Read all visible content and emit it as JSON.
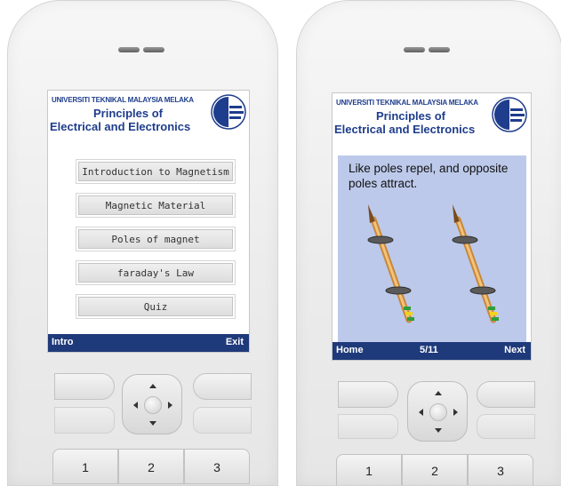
{
  "header": {
    "university": "UNIVERSITI TEKNIKAL MALAYSIA MELAKA",
    "title_line1": "Principles of",
    "title_line2": "Electrical and Electronics"
  },
  "menu_screen": {
    "buttons": [
      "Introduction to Magnetism",
      "Magnetic Material",
      "Poles of magnet",
      "faraday's Law",
      "Quiz"
    ],
    "softkey_left": "Intro",
    "softkey_right": "Exit"
  },
  "slide_screen": {
    "text": "Like poles repel, and opposite poles attract.",
    "softkey_left": "Home",
    "page_indicator": "5/11",
    "softkey_right": "Next"
  },
  "keypad": {
    "numbers": [
      "1",
      "2",
      "3"
    ]
  },
  "colors": {
    "brand_blue": "#1e3d8c",
    "softbar": "#1f3a7a",
    "slide_bg": "#bcc9ea"
  },
  "icons": [
    "university-logo",
    "dpad-up-arrow",
    "dpad-down-arrow",
    "dpad-left-arrow",
    "dpad-right-arrow",
    "magnet-pen-illustration"
  ]
}
